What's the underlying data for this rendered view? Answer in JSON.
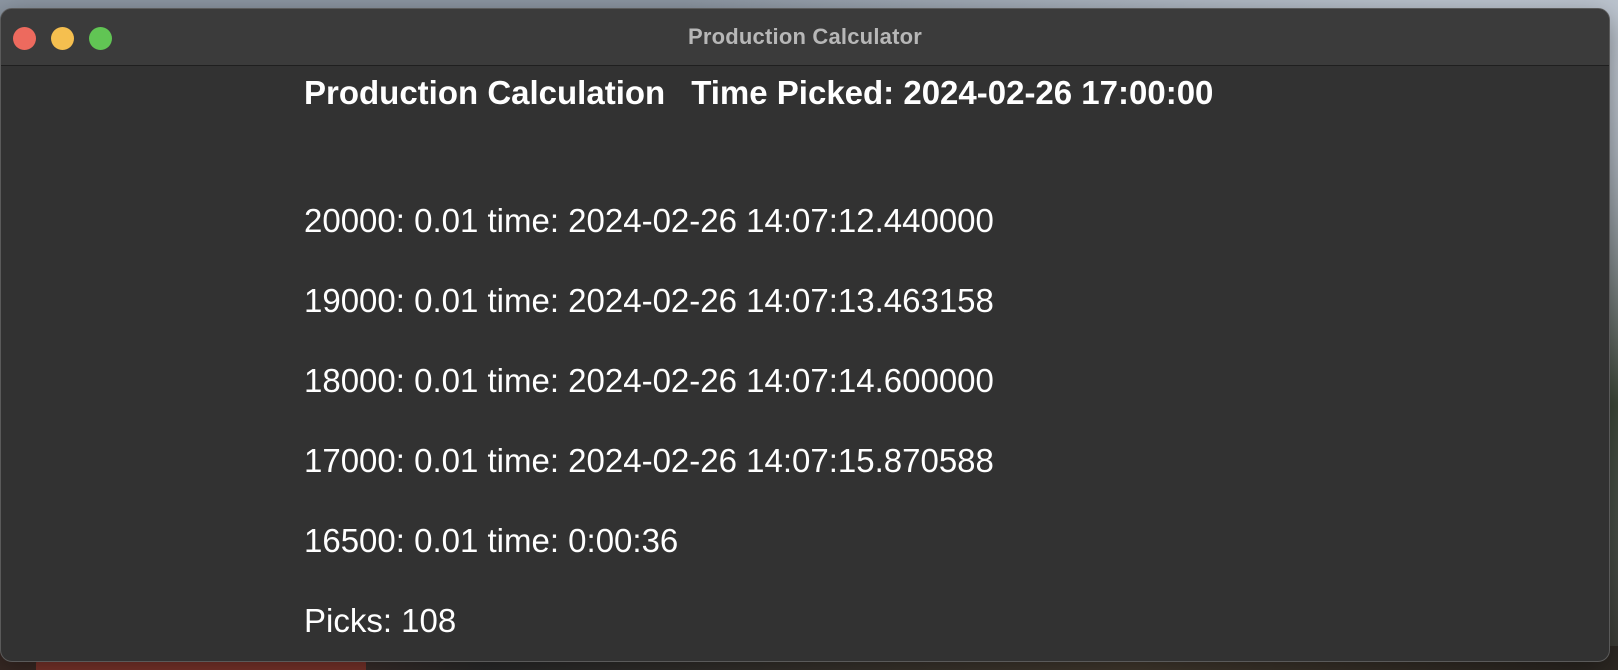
{
  "window": {
    "title": "Production Calculator"
  },
  "header": {
    "heading": "Production Calculation",
    "time_picked": "Time Picked: 2024-02-26 17:00:00"
  },
  "rows": [
    "20000: 0.01 time: 2024-02-26 14:07:12.440000",
    "19000: 0.01 time: 2024-02-26 14:07:13.463158",
    "18000: 0.01 time: 2024-02-26 14:07:14.600000",
    "17000: 0.01 time: 2024-02-26 14:07:15.870588",
    "16500: 0.01 time: 0:00:36"
  ],
  "summary": {
    "picks": "Picks: 108"
  },
  "colors": {
    "window_bg": "#323232",
    "titlebar_bg": "#3b3b3b",
    "close": "#ed6a5e",
    "minimize": "#f5bf4f",
    "maximize": "#61c554",
    "text": "#ffffff"
  }
}
